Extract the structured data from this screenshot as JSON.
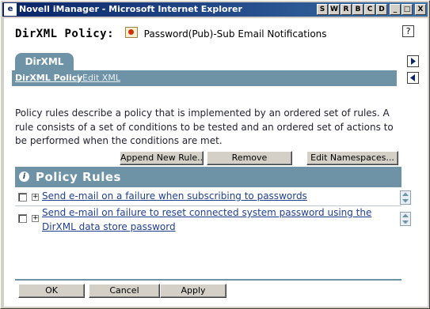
{
  "window": {
    "title": "Novell iManager - Microsoft Internet Explorer",
    "title_buttons": [
      "S",
      "W",
      "R",
      "B",
      "C",
      "D",
      "_",
      "□",
      "X"
    ]
  },
  "header": {
    "title": "DirXML Policy:",
    "policy_name": "Password(Pub)-Sub Email Notifications",
    "help_label": "?"
  },
  "tabs": {
    "active_tab": "DirXML",
    "links": [
      {
        "label": "DirXML Policy"
      },
      {
        "label": "Edit XML"
      }
    ],
    "separator": "|"
  },
  "description": "Policy rules describe a policy that is implemented by an ordered set of rules. A rule consists of a set of conditions to be tested and an ordered set of actions to be performed when the conditions are met.",
  "toolbar": {
    "append_label": "Append New Rule...",
    "remove_label": "Remove",
    "edit_ns_label": "Edit Namespaces..."
  },
  "rules_section": {
    "title": "Policy Rules",
    "info_icon": "i",
    "rules": [
      {
        "label": "Send e-mail on a failure when subscribing to passwords"
      },
      {
        "label": "Send e-mail on failure to reset connected system password using the DirXML data store password"
      }
    ]
  },
  "footer": {
    "ok_label": "OK",
    "cancel_label": "Cancel",
    "apply_label": "Apply"
  },
  "icons": {
    "app": "ie-page-icon",
    "policy": "policy-icon",
    "help": "help-icon",
    "nav_forward": "arrow-right-icon",
    "nav_back": "arrow-left-icon",
    "info": "info-icon",
    "expand": "plus-icon",
    "reorder": "up-down-arrows-icon"
  },
  "colors": {
    "titlebar": "#0a246a",
    "accent": "#6f93a6",
    "link": "#1f3f8f"
  }
}
